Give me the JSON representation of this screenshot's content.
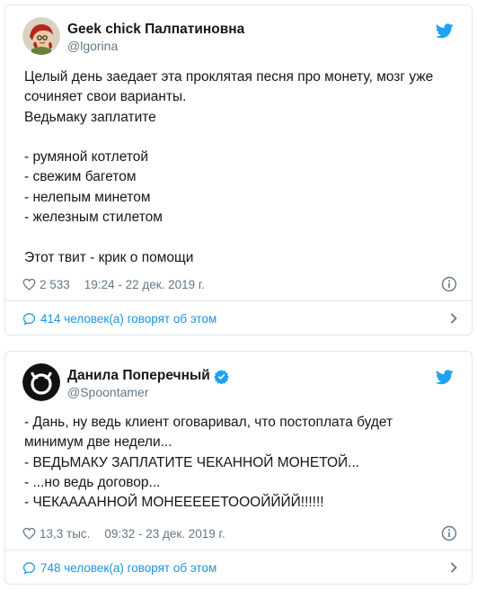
{
  "colors": {
    "text": "#14171a",
    "secondary": "#657786",
    "link": "#1b95e0",
    "border": "#e1e8ed",
    "twitter_blue": "#1da1f2"
  },
  "tweets": [
    {
      "author": {
        "name": "Geek chick Палпатиновна",
        "handle": "@lgorina",
        "verified": false
      },
      "text": "Целый день заедает эта проклятая песня про монету, мозг уже\nсочиняет свои варианты.\nВедьмаку заплатите\n\n- румяной котлетой\n- свежим багетом\n- нелепым минетом\n- железным стилетом\n\nЭтот твит - крик о помощи",
      "likes": "2 533",
      "timestamp": "19:24 - 22 дек. 2019 г.",
      "conversation": "414 человек(а) говорят об этом",
      "icons": [
        "heart-icon",
        "info-icon",
        "bubble-icon",
        "chevron-right-icon",
        "twitter-bird-icon"
      ]
    },
    {
      "author": {
        "name": "Данила Поперечный",
        "handle": "@Spoontamer",
        "verified": true
      },
      "text": "- Дань, ну ведь клиент оговаривал, что постоплата будет\nминимум две недели...\n- ВЕДЬМАКУ ЗАПЛАТИТЕ ЧЕКАННОЙ МОНЕТОЙ...\n- ...но ведь договор...\n- ЧЕКААААННОЙ МОНЕЕЕЕЕТОООЙЙЙЙ!!!!!!",
      "likes": "13,3 тыс.",
      "timestamp": "09:32 - 23 дек. 2019 г.",
      "conversation": "748 человек(а) говорят об этом",
      "icons": [
        "heart-icon",
        "info-icon",
        "bubble-icon",
        "chevron-right-icon",
        "twitter-bird-icon",
        "verified-icon"
      ]
    }
  ]
}
